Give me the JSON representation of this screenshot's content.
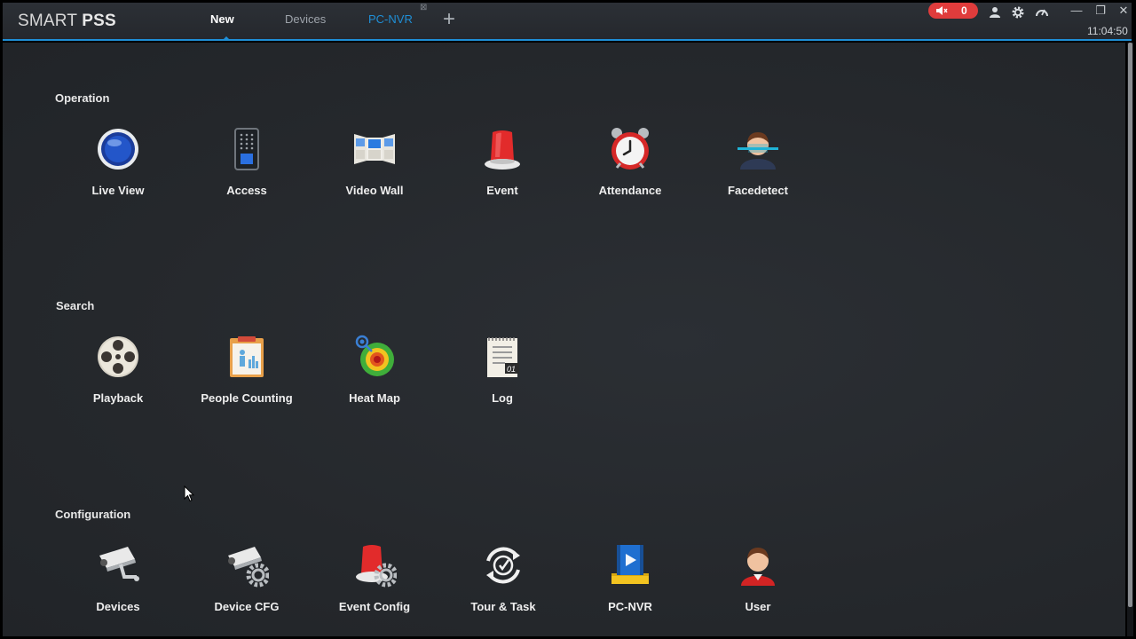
{
  "app": {
    "logo_light": "SMART ",
    "logo_bold": "PSS",
    "clock": "11:04:50",
    "alarm_count": "0"
  },
  "tabs": [
    {
      "label": "New",
      "active": true
    },
    {
      "label": "Devices",
      "active": false
    },
    {
      "label": "PC-NVR",
      "active": false
    }
  ],
  "window_buttons": {
    "minimize": "—",
    "restore": "❐",
    "close": "✕"
  },
  "sections": {
    "operation": {
      "title": "Operation",
      "items": [
        {
          "label": "Live View",
          "icon": "live-view-icon"
        },
        {
          "label": "Access",
          "icon": "access-icon"
        },
        {
          "label": "Video Wall",
          "icon": "video-wall-icon"
        },
        {
          "label": "Event",
          "icon": "event-icon"
        },
        {
          "label": "Attendance",
          "icon": "attendance-icon"
        },
        {
          "label": "Facedetect",
          "icon": "facedetect-icon"
        }
      ]
    },
    "search": {
      "title": "Search",
      "items": [
        {
          "label": "Playback",
          "icon": "playback-icon"
        },
        {
          "label": "People Counting",
          "icon": "people-counting-icon"
        },
        {
          "label": "Heat Map",
          "icon": "heat-map-icon"
        },
        {
          "label": "Log",
          "icon": "log-icon"
        }
      ]
    },
    "configuration": {
      "title": "Configuration",
      "items": [
        {
          "label": "Devices",
          "icon": "devices-icon"
        },
        {
          "label": "Device CFG",
          "icon": "device-cfg-icon"
        },
        {
          "label": "Event Config",
          "icon": "event-config-icon"
        },
        {
          "label": "Tour & Task",
          "icon": "tour-task-icon"
        },
        {
          "label": "PC-NVR",
          "icon": "pc-nvr-icon"
        },
        {
          "label": "User",
          "icon": "user-icon"
        }
      ]
    }
  },
  "colors": {
    "accent": "#1f8fd6",
    "alarm": "#e03c3c",
    "background": "#26292d"
  }
}
